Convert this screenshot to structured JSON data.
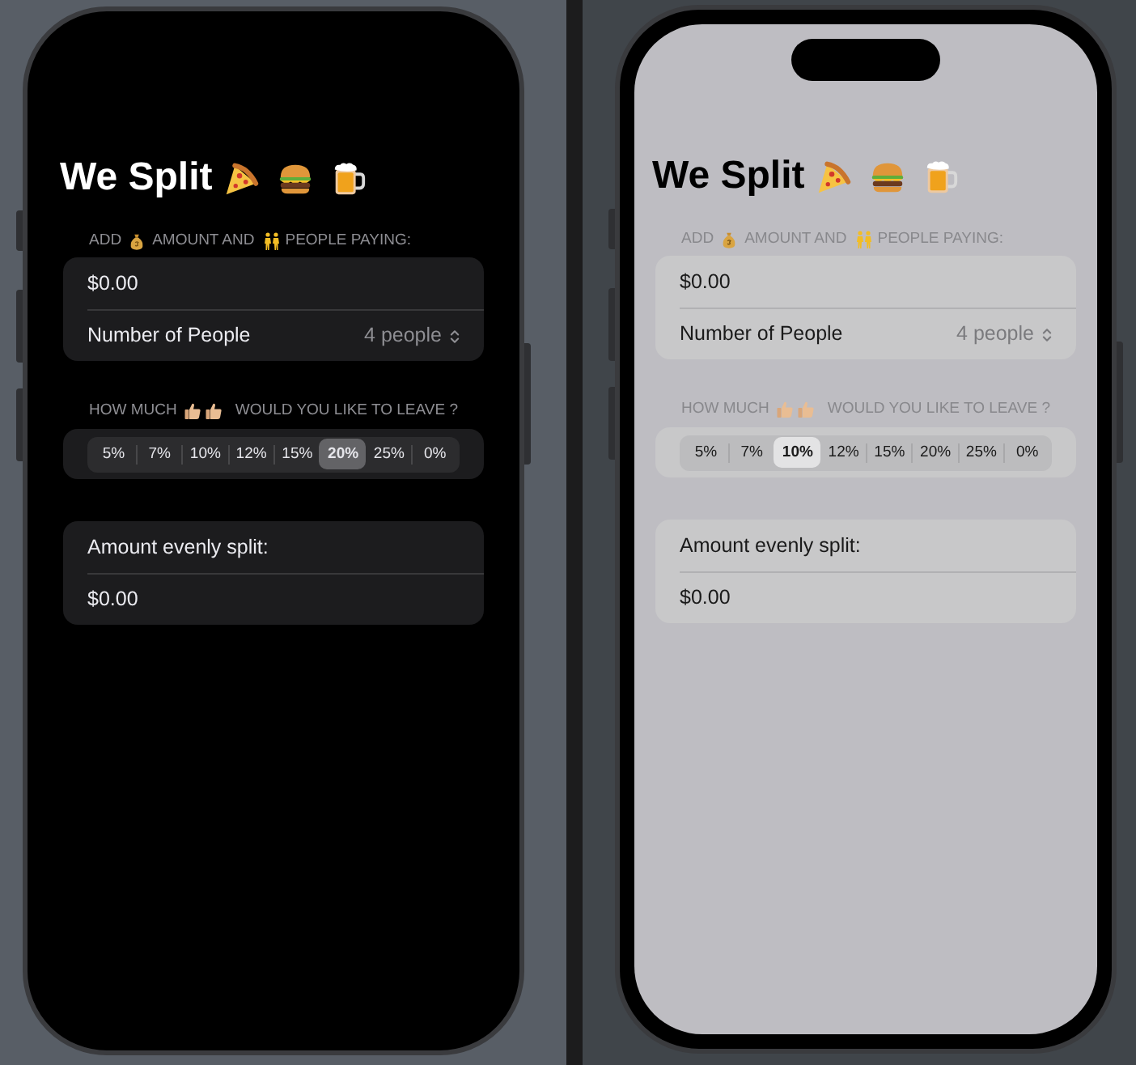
{
  "phones": [
    {
      "kind": "dark",
      "title": "We Split",
      "input_section": {
        "header": [
          "ADD",
          "AMOUNT AND",
          "PEOPLE PAYING:"
        ],
        "amount_field": {
          "value": "$0.00"
        },
        "people_picker": {
          "label": "Number of People",
          "value": "4 people"
        }
      },
      "tip_section": {
        "header": [
          "HOW MUCH",
          "WOULD YOU LIKE TO LEAVE ?"
        ],
        "options": [
          {
            "label": "5%",
            "selected": false
          },
          {
            "label": "7%",
            "selected": false
          },
          {
            "label": "10%",
            "selected": false
          },
          {
            "label": "12%",
            "selected": false
          },
          {
            "label": "15%",
            "selected": false
          },
          {
            "label": "20%",
            "selected": true
          },
          {
            "label": "25%",
            "selected": false
          },
          {
            "label": "0%",
            "selected": false
          }
        ]
      },
      "result_section": {
        "label": "Amount evenly split:",
        "value": "$0.00"
      }
    },
    {
      "kind": "light",
      "title": "We Split",
      "input_section": {
        "header": [
          "ADD",
          "AMOUNT AND",
          "PEOPLE PAYING:"
        ],
        "amount_field": {
          "value": "$0.00"
        },
        "people_picker": {
          "label": "Number of People",
          "value": "4 people"
        }
      },
      "tip_section": {
        "header": [
          "HOW MUCH",
          "WOULD YOU LIKE TO LEAVE ?"
        ],
        "options": [
          {
            "label": "5%",
            "selected": false
          },
          {
            "label": "7%",
            "selected": false
          },
          {
            "label": "10%",
            "selected": true
          },
          {
            "label": "12%",
            "selected": false
          },
          {
            "label": "15%",
            "selected": false
          },
          {
            "label": "20%",
            "selected": false
          },
          {
            "label": "25%",
            "selected": false
          },
          {
            "label": "0%",
            "selected": false
          }
        ]
      },
      "result_section": {
        "label": "Amount evenly split:",
        "value": "$0.00"
      }
    }
  ]
}
